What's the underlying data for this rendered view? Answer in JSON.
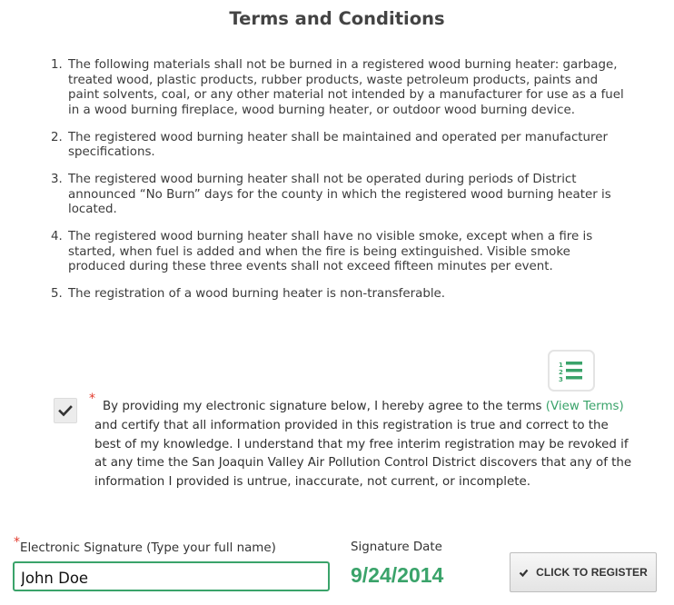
{
  "page": {
    "title": "Terms and Conditions"
  },
  "terms": [
    {
      "number": "1.",
      "text": "The following materials shall not be burned in a registered wood burning heater: garbage, treated wood, plastic products, rubber products, waste petroleum products, paints and paint solvents, coal, or any other material not intended by a manufacturer for use as a fuel in a wood burning fireplace, wood burning heater, or outdoor wood burning device."
    },
    {
      "number": "2.",
      "text": "The registered wood burning heater shall be maintained and operated per manufacturer specifications."
    },
    {
      "number": "3.",
      "text": "The registered wood burning heater shall not be operated during periods of District announced “No Burn” days for the county in which the registered wood burning heater is located."
    },
    {
      "number": "4.",
      "text": "The registered wood burning heater shall have no visible smoke, except when a fire is started, when fuel is added and when the fire is being extinguished. Visible smoke produced during these three events shall not exceed fifteen minutes per event."
    },
    {
      "number": "5.",
      "text": "The registration of a wood burning heater is non-transferable."
    }
  ],
  "agreement": {
    "checked": true,
    "required_mark": "*",
    "text_before_link": "By providing my electronic signature below, I hereby agree to the terms",
    "link_label": "(View Terms)",
    "text_after_link": "and certify that all information provided in this registration is true and correct to the best of my knowledge. I understand that my free interim registration may be revoked if at any time the San Joaquin Valley Air Pollution Control District discovers that any of the information I provided is untrue, inaccurate, not current, or incomplete.",
    "icon": "numbered-list-icon",
    "check_icon": "checkmark-icon"
  },
  "signature": {
    "required_mark": "*",
    "label": "Electronic Signature (Type your full name)",
    "value": "John Doe"
  },
  "signature_date": {
    "label": "Signature Date",
    "value": "9/24/2014"
  },
  "register_button": {
    "label": "CLICK TO REGISTER",
    "icon": "checkmark-icon"
  },
  "colors": {
    "accent": "#3aa36a",
    "required": "#e23b2e",
    "text": "#333333"
  }
}
